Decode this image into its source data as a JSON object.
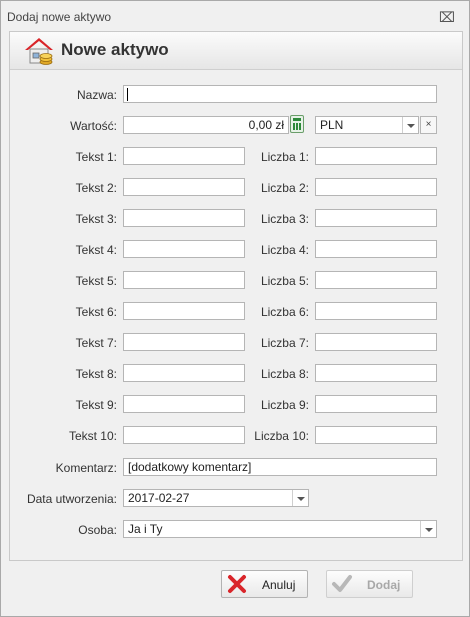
{
  "window": {
    "title": "Dodaj nowe aktywo",
    "close_glyph": "⌧"
  },
  "header": {
    "title": "Nowe aktywo",
    "icon": "house-coins-icon"
  },
  "form": {
    "name": {
      "label": "Nazwa:",
      "value": ""
    },
    "value": {
      "label": "Wartość:",
      "amount": "0,00 zł",
      "currency": "PLN",
      "clear_glyph": "×"
    },
    "texts": [
      {
        "label": "Tekst 1:",
        "value": ""
      },
      {
        "label": "Tekst 2:",
        "value": ""
      },
      {
        "label": "Tekst 3:",
        "value": ""
      },
      {
        "label": "Tekst 4:",
        "value": ""
      },
      {
        "label": "Tekst 5:",
        "value": ""
      },
      {
        "label": "Tekst 6:",
        "value": ""
      },
      {
        "label": "Tekst 7:",
        "value": ""
      },
      {
        "label": "Tekst 8:",
        "value": ""
      },
      {
        "label": "Tekst 9:",
        "value": ""
      },
      {
        "label": "Tekst 10:",
        "value": ""
      }
    ],
    "numbers": [
      {
        "label": "Liczba 1:",
        "value": ""
      },
      {
        "label": "Liczba 2:",
        "value": ""
      },
      {
        "label": "Liczba 3:",
        "value": ""
      },
      {
        "label": "Liczba 4:",
        "value": ""
      },
      {
        "label": "Liczba 5:",
        "value": ""
      },
      {
        "label": "Liczba 6:",
        "value": ""
      },
      {
        "label": "Liczba 7:",
        "value": ""
      },
      {
        "label": "Liczba 8:",
        "value": ""
      },
      {
        "label": "Liczba 9:",
        "value": ""
      },
      {
        "label": "Liczba 10:",
        "value": ""
      }
    ],
    "comment": {
      "label": "Komentarz:",
      "value": "[dodatkowy komentarz]"
    },
    "date": {
      "label": "Data utworzenia:",
      "value": "2017-02-27"
    },
    "person": {
      "label": "Osoba:",
      "value": "Ja i Ty"
    }
  },
  "buttons": {
    "cancel": {
      "label": "Anuluj",
      "icon": "red-x-icon"
    },
    "add": {
      "label": "Dodaj",
      "icon": "checkmark-icon",
      "disabled": true
    }
  },
  "colors": {
    "accent_red": "#d9252a",
    "window_bg": "#f0f0f0"
  }
}
